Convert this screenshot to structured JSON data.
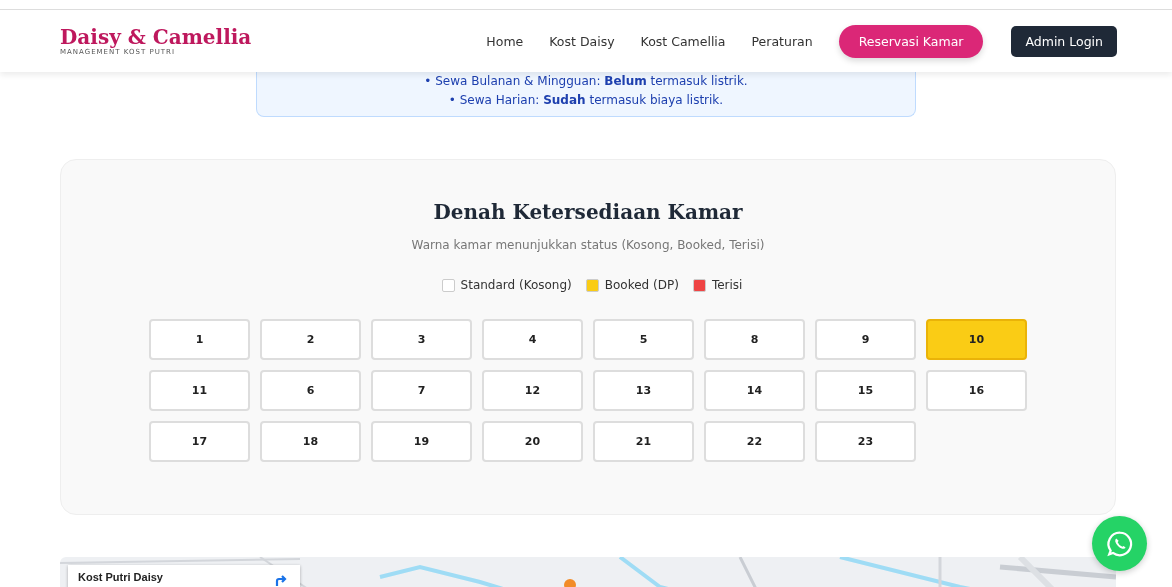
{
  "brand": {
    "name": "Daisy & Camellia",
    "tagline": "MANAGEMENT KOST PUTRI"
  },
  "nav": [
    {
      "label": "Home",
      "kind": "link"
    },
    {
      "label": "Kost Daisy",
      "kind": "link"
    },
    {
      "label": "Kost Camellia",
      "kind": "link"
    },
    {
      "label": "Peraturan",
      "kind": "link"
    },
    {
      "label": "Reservasi Kamar",
      "kind": "primary"
    },
    {
      "label": "Admin Login",
      "kind": "dark"
    }
  ],
  "notice": [
    "• Sewa Bulanan & Mingguan: **Belum** termasuk listrik.",
    "• Sewa Harian: **Sudah** termasuk biaya listrik."
  ],
  "availability": {
    "title": "Denah Ketersediaan Kamar",
    "subtitle": "Warna kamar menunjukkan status (Kosong, Booked, Terisi)",
    "legend": [
      {
        "label": "Standard (Kosong)",
        "color": "#ffffff"
      },
      {
        "label": "Booked (DP)",
        "color": "#facc15"
      },
      {
        "label": "Terisi",
        "color": "#ef4444"
      }
    ],
    "rooms": [
      {
        "number": "1",
        "kind": "vacant"
      },
      {
        "number": "2",
        "kind": "vacant"
      },
      {
        "number": "3",
        "kind": "vacant"
      },
      {
        "number": "4",
        "kind": "vacant"
      },
      {
        "number": "5",
        "kind": "vacant"
      },
      {
        "number": "8",
        "kind": "vacant"
      },
      {
        "number": "9",
        "kind": "vacant"
      },
      {
        "number": "10",
        "kind": "booked"
      },
      {
        "number": "11",
        "kind": "vacant"
      },
      {
        "number": "6",
        "kind": "vacant"
      },
      {
        "number": "7",
        "kind": "vacant"
      },
      {
        "number": "12",
        "kind": "vacant"
      },
      {
        "number": "13",
        "kind": "vacant"
      },
      {
        "number": "14",
        "kind": "vacant"
      },
      {
        "number": "15",
        "kind": "vacant"
      },
      {
        "number": "16",
        "kind": "vacant"
      },
      {
        "number": "17",
        "kind": "vacant"
      },
      {
        "number": "18",
        "kind": "vacant"
      },
      {
        "number": "19",
        "kind": "vacant"
      },
      {
        "number": "20",
        "kind": "vacant"
      },
      {
        "number": "21",
        "kind": "vacant"
      },
      {
        "number": "22",
        "kind": "vacant"
      },
      {
        "number": "23",
        "kind": "vacant"
      }
    ]
  },
  "map": {
    "place_card": {
      "title": "Kost Putri Daisy"
    }
  }
}
